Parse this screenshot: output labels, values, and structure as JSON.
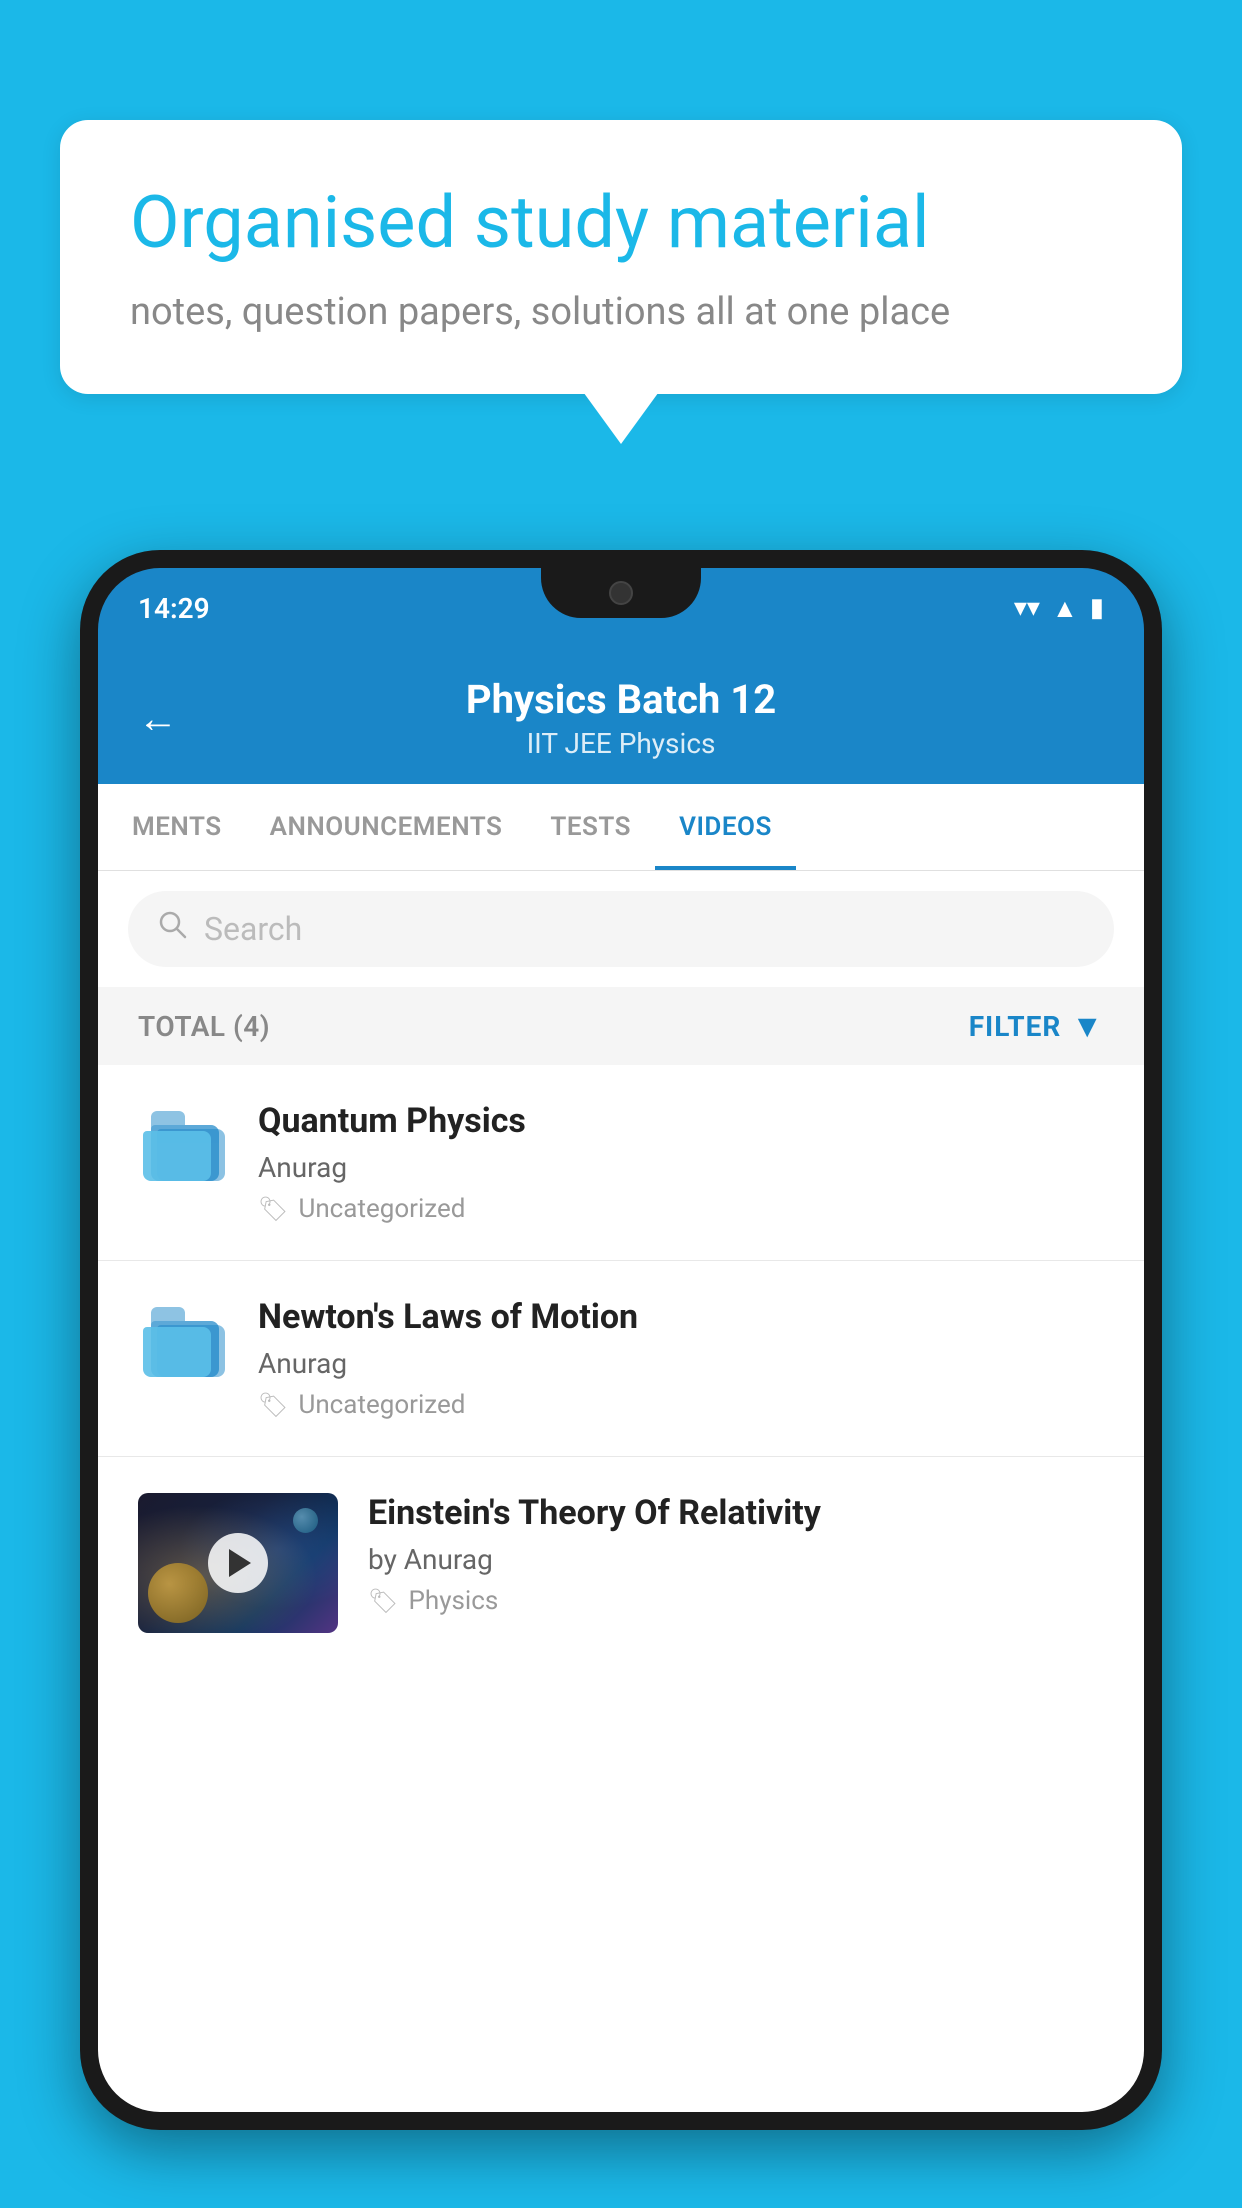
{
  "hero": {
    "title": "Organised study material",
    "subtitle": "notes, question papers, solutions all at one place"
  },
  "phone": {
    "status": {
      "time": "14:29"
    },
    "header": {
      "title": "Physics Batch 12",
      "subtitle": "IIT JEE   Physics",
      "back_label": "←"
    },
    "tabs": [
      {
        "label": "MENTS",
        "active": false
      },
      {
        "label": "ANNOUNCEMENTS",
        "active": false
      },
      {
        "label": "TESTS",
        "active": false
      },
      {
        "label": "VIDEOS",
        "active": true
      }
    ],
    "search": {
      "placeholder": "Search"
    },
    "filter": {
      "total_label": "TOTAL (4)",
      "filter_label": "FILTER"
    },
    "videos": [
      {
        "title": "Quantum Physics",
        "author": "Anurag",
        "tag": "Uncategorized",
        "type": "folder"
      },
      {
        "title": "Newton's Laws of Motion",
        "author": "Anurag",
        "tag": "Uncategorized",
        "type": "folder"
      },
      {
        "title": "Einstein's Theory Of Relativity",
        "author": "by Anurag",
        "tag": "Physics",
        "type": "video"
      }
    ]
  }
}
